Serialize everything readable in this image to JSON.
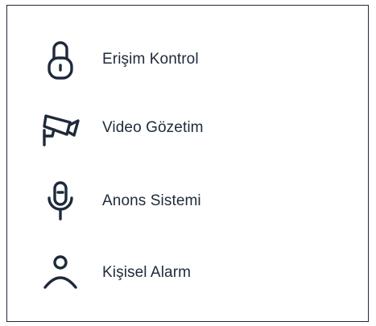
{
  "menu": {
    "items": [
      {
        "label": "Erişim Kontrol",
        "icon": "padlock-icon"
      },
      {
        "label": "Video Gözetim",
        "icon": "security-camera-icon"
      },
      {
        "label": "Anons Sistemi",
        "icon": "microphone-icon"
      },
      {
        "label": "Kişisel Alarm",
        "icon": "person-icon"
      }
    ]
  },
  "colors": {
    "text": "#1e2a3a",
    "border": "#1e2a3a",
    "background": "#ffffff"
  }
}
